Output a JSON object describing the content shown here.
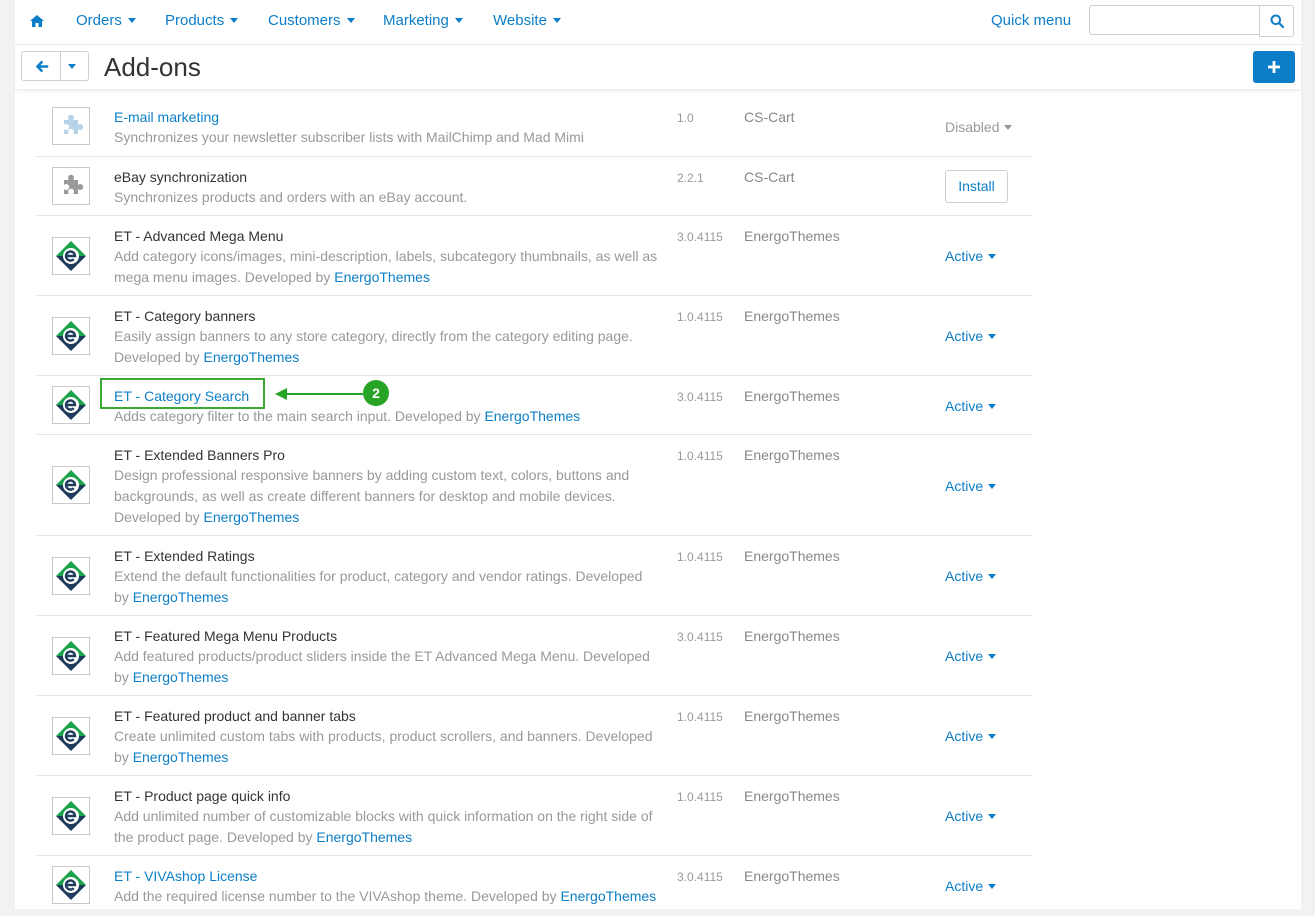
{
  "nav": {
    "home_icon": "home-icon",
    "items": [
      {
        "label": "Orders"
      },
      {
        "label": "Products"
      },
      {
        "label": "Customers"
      },
      {
        "label": "Marketing"
      },
      {
        "label": "Website"
      }
    ],
    "quick_menu": "Quick menu",
    "search_placeholder": "",
    "search_icon": "search-icon"
  },
  "titlebar": {
    "title": "Add-ons",
    "back_icon": "arrow-left-icon",
    "add_icon": "plus-icon"
  },
  "addons": [
    {
      "name": "E-mail marketing",
      "name_link": true,
      "desc": "Synchronizes your newsletter subscriber lists with MailChimp and Mad Mimi",
      "developer": "",
      "version": "1.0",
      "vendor": "CS-Cart",
      "status": "Disabled",
      "icon": "puzzle-piece-icon"
    },
    {
      "name": "eBay synchronization",
      "name_link": false,
      "desc": "Synchronizes products and orders with an eBay account.",
      "developer": "",
      "version": "2.2.1",
      "vendor": "CS-Cart",
      "status": "Install",
      "icon": "puzzle-piece-icon"
    },
    {
      "name": "ET - Advanced Mega Menu",
      "name_link": false,
      "desc": "Add category icons/images, mini-description, labels, subcategory thumbnails, as well as mega menu images. Developed by",
      "developer": "EnergoThemes",
      "version": "3.0.4115",
      "vendor": "EnergoThemes",
      "status": "Active",
      "icon": "energothemes-logo-icon"
    },
    {
      "name": "ET - Category banners",
      "name_link": false,
      "desc": "Easily assign banners to any store category, directly from the category editing page. Developed by",
      "developer": "EnergoThemes",
      "version": "1.0.4115",
      "vendor": "EnergoThemes",
      "status": "Active",
      "icon": "energothemes-logo-icon"
    },
    {
      "name": "ET - Category Search",
      "name_link": true,
      "desc": "Adds category filter to the main search input. Developed by",
      "developer": "EnergoThemes",
      "version": "3.0.4115",
      "vendor": "EnergoThemes",
      "status": "Active",
      "icon": "energothemes-logo-icon"
    },
    {
      "name": "ET - Extended Banners Pro",
      "name_link": false,
      "desc": "Design professional responsive banners by adding custom text, colors, buttons and backgrounds, as well as create different banners for desktop and mobile devices. Developed by",
      "developer": "EnergoThemes",
      "version": "1.0.4115",
      "vendor": "EnergoThemes",
      "status": "Active",
      "icon": "energothemes-logo-icon"
    },
    {
      "name": "ET - Extended Ratings",
      "name_link": false,
      "desc": "Extend the default functionalities for product, category and vendor ratings. Developed by",
      "developer": "EnergoThemes",
      "version": "1.0.4115",
      "vendor": "EnergoThemes",
      "status": "Active",
      "icon": "energothemes-logo-icon"
    },
    {
      "name": "ET - Featured Mega Menu Products",
      "name_link": false,
      "desc": "Add featured products/product sliders inside the ET Advanced Mega Menu. Developed by",
      "developer": "EnergoThemes",
      "version": "3.0.4115",
      "vendor": "EnergoThemes",
      "status": "Active",
      "icon": "energothemes-logo-icon"
    },
    {
      "name": "ET - Featured product and banner tabs",
      "name_link": false,
      "desc": "Create unlimited custom tabs with products, product scrollers, and banners. Developed by",
      "developer": "EnergoThemes",
      "version": "1.0.4115",
      "vendor": "EnergoThemes",
      "status": "Active",
      "icon": "energothemes-logo-icon"
    },
    {
      "name": "ET - Product page quick info",
      "name_link": false,
      "desc": "Add unlimited number of customizable blocks with quick information on the right side of the product page. Developed by",
      "developer": "EnergoThemes",
      "version": "1.0.4115",
      "vendor": "EnergoThemes",
      "status": "Active",
      "icon": "energothemes-logo-icon"
    },
    {
      "name": "ET - VIVAshop License",
      "name_link": true,
      "desc": "Add the required license number to the VIVAshop theme. Developed by",
      "developer": "EnergoThemes",
      "version": "3.0.4115",
      "vendor": "EnergoThemes",
      "status": "Active",
      "icon": "energothemes-logo-icon"
    }
  ],
  "annotation": {
    "step": "2"
  },
  "colors": {
    "accent": "#0c7ec7",
    "annotation_green": "#27a425",
    "logo_green": "#1aa34a",
    "logo_navy": "#1f3b5c"
  }
}
